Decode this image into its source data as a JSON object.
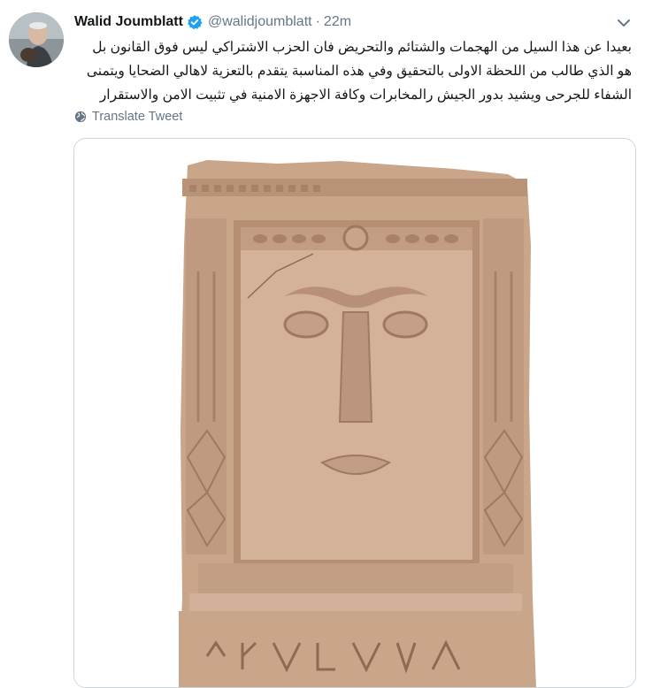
{
  "tweet": {
    "author_name": "Walid Joumblatt",
    "handle": "@walidjoumblatt",
    "separator": "·",
    "time": "22m",
    "text": "بعيدا عن هذا السيل من الهجمات والشتائم والتحريض فان الحزب الاشتراكي ليس فوق القانون بل هو الذي طالب من اللحظة الاولى بالتحقيق وفي هذه المناسبة يتقدم بالتعزية لاهالي الضحايا ويتمنى الشفاء للجرحى ويشيد بدور الجيش رالمخابرات وكافة الاجهزة الامنية في تثبيت الامن والاستقرار",
    "translate_label": "Translate Tweet"
  },
  "icons": {
    "verified": "verified-badge-icon",
    "chevron": "chevron-down-icon",
    "globe": "globe-icon"
  },
  "colors": {
    "accent": "#1da1f2",
    "secondary_text": "#657786",
    "primary_text": "#14171a",
    "border": "#ccd6dd",
    "stone": "#c9a58a"
  }
}
